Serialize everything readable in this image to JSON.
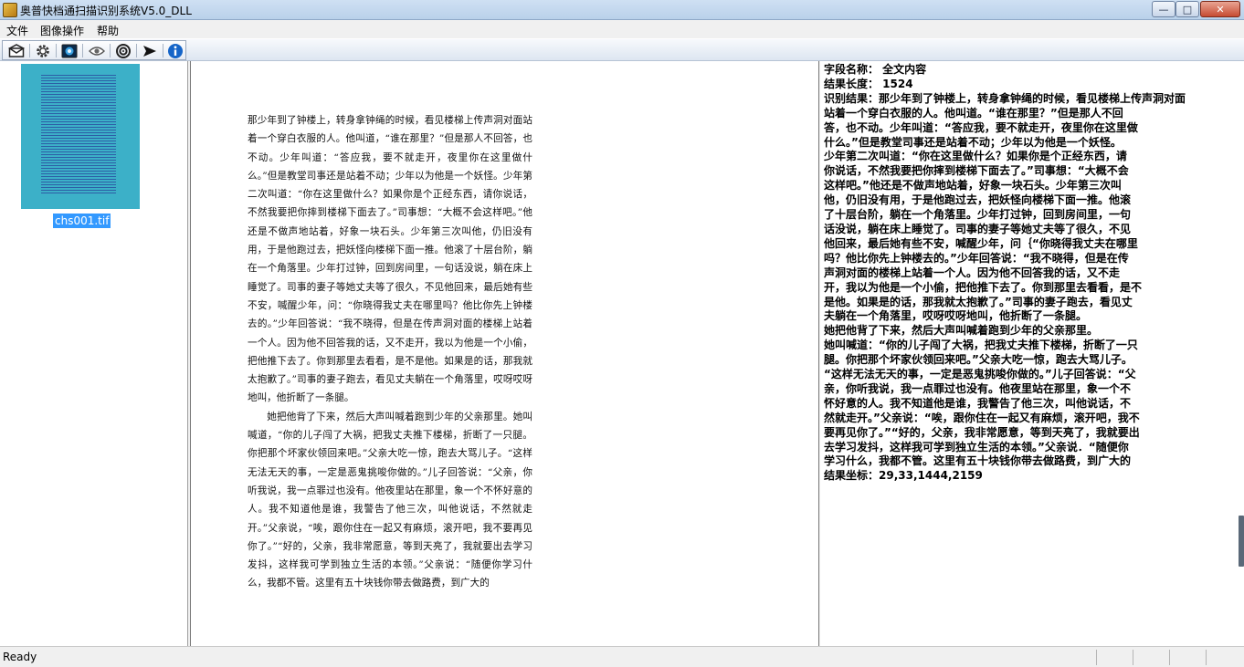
{
  "window": {
    "title": "奥普快档通扫描识别系统V5.0_DLL",
    "controls": {
      "minimize": "—",
      "maximize": "□",
      "close": "✕"
    }
  },
  "menu": {
    "items": [
      "文件",
      "图像操作",
      "帮助"
    ]
  },
  "toolbar": {
    "buttons": [
      "envelope-icon",
      "gear-icon",
      "image-icon",
      "eye-icon",
      "target-icon",
      "send-arrow-icon",
      "info-icon"
    ]
  },
  "thumbnails": [
    {
      "filename": "chs001.tif"
    }
  ],
  "document": {
    "paragraphs": [
      "那少年到了钟楼上，转身拿钟绳的时候，看见楼梯上传声洞对面站着一个穿白衣服的人。他叫道，“谁在那里？”但是那人不回答，也不动。少年叫道：“答应我，要不就走开，夜里你在这里做什么。”但是教堂司事还是站着不动；少年以为他是一个妖怪。少年第二次叫道：“你在这里做什么？如果你是个正经东西，请你说话，不然我要把你摔到楼梯下面去了。”司事想：“大概不会这样吧。”他还是不做声地站着，好象一块石头。少年第三次叫他，仍旧没有用，于是他跑过去，把妖怪向楼梯下面一推。他滚了十层台阶，躺在一个角落里。少年打过钟，回到房间里，一句话没说，躺在床上睡觉了。司事的妻子等她丈夫等了很久，不见他回来，最后她有些不安，喊醒少年，问：“你晓得我丈夫在哪里吗？他比你先上钟楼去的。”少年回答说：“我不晓得，但是在传声洞对面的楼梯上站着一个人。因为他不回答我的话，又不走开，我以为他是一个小偷，把他推下去了。你到那里去看看，是不是他。如果是的话，那我就太抱歉了。”司事的妻子跑去，看见丈夫躺在一个角落里，哎呀哎呀地叫，他折断了一条腿。",
      "她把他背了下来，然后大声叫喊着跑到少年的父亲那里。她叫喊道，“你的儿子闯了大祸，把我丈夫推下楼梯，折断了一只腿。你把那个坏家伙领回来吧。”父亲大吃一惊，跑去大骂儿子。“这样无法无天的事，一定是恶鬼挑唆你做的。”儿子回答说：“父亲，你听我说，我一点罪过也没有。他夜里站在那里，象一个不怀好意的人。我不知道他是谁，我警告了他三次，叫他说话，不然就走开。”父亲说，“唉，跟你住在一起又有麻烦，滚开吧，我不要再见你了。”“好的，父亲，我非常愿意，等到天亮了，我就要出去学习发抖，这样我可学到独立生活的本领。”父亲说：“随便你学习什么，我都不管。这里有五十块钱你带去做路费，到广大的"
    ]
  },
  "result": {
    "lines": [
      "字段名称： 全文内容",
      "结果长度： 1524",
      "识别结果：那少年到了钟楼上，转身拿钟绳的时候，看见楼梯上传声洞对面",
      "站着一个穿白衣服的人。他叫道。“谁在那里？”但是那人不回",
      "答，也不动。少年叫道：“答应我，要不就走开，夜里你在这里做",
      "什么。”但是教堂司事还是站着不动；少年以为他是一个妖怪。",
      "少年第二次叫道：“你在这里做什么？如果你是个正经东西，请",
      "你说话，不然我要把你摔到楼梯下面去了。”司事想：“大概不会",
      "这样吧。”他还是不做声地站着，好象一块石头。少年第三次叫",
      "他，仍旧没有用，于是他跑过去，把妖怪向楼梯下面一推。他滚",
      "了十层台阶，躺在一个角落里。少年打过钟，回到房间里，一句",
      "话没说，躺在床上睡觉了。司事的妻子等她丈夫等了很久，不见",
      "他回来，最后她有些不安，喊醒少年，问｛“你晓得我丈夫在哪里",
      "吗？他比你先上钟楼去的。”少年回答说：“我不晓得，但是在传",
      "声洞对面的楼梯上站着一个人。因为他不回答我的话，又不走",
      "开，我以为他是一个小偷，把他推下去了。你到那里去看看，是不",
      "是他。如果是的话，那我就太抱歉了。”司事的妻子跑去，看见丈",
      "夫躺在一个角落里，哎呀哎呀地叫，他折断了一条腿。",
      "    她把他背了下来，然后大声叫喊着跑到少年的父亲那里。",
      "她叫喊道：“你的儿子闯了大祸，把我丈夫推下楼梯，折断了一只",
      "腿。你把那个坏家伙领回来吧。”父亲大吃一惊，跑去大骂儿子。",
      "“这样无法无天的事，一定是恶鬼挑唆你做的。”儿子回答说：“父",
      "亲，你听我说，我一点罪过也没有。他夜里站在那里，象一个不",
      "怀好意的人。我不知道他是谁，我警告了他三次，叫他说话，不",
      "然就走开。”父亲说：“唉，跟你住在一起又有麻烦，滚开吧，我不",
      "要再见你了。”“好的，父亲，我非常愿意，等到天亮了，我就要出",
      "去学习发抖，这样我可学到独立生活的本领。”父亲说．“随便你",
      "学习什么，我都不管。这里有五十块钱你带去做路费，到广大的",
      "结果坐标：29,33,1444,2159"
    ]
  },
  "status": {
    "text": "Ready"
  }
}
